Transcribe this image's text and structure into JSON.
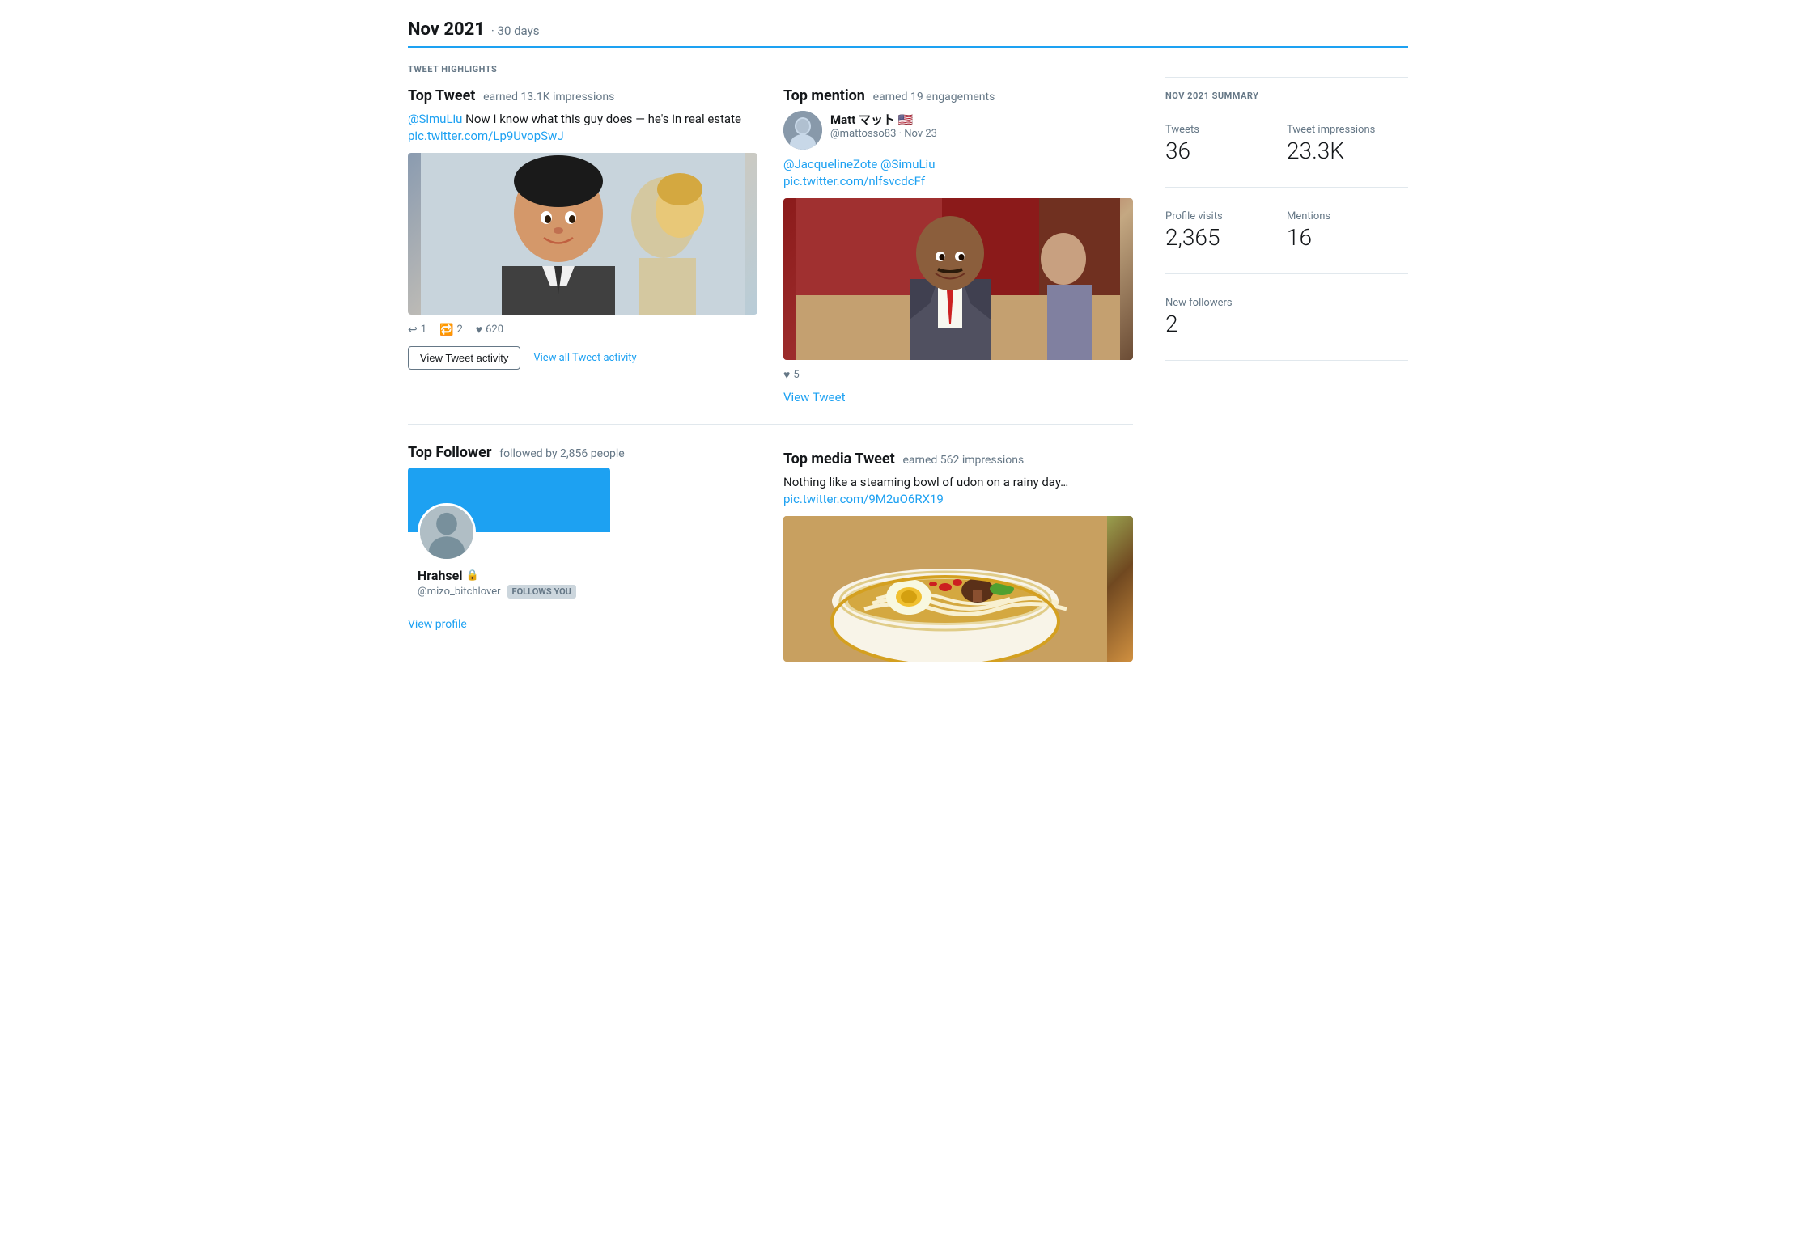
{
  "page": {
    "title": "Nov 2021",
    "subtitle": "· 30 days"
  },
  "highlights_label": "TWEET HIGHLIGHTS",
  "top_tweet": {
    "label": "Top Tweet",
    "impressions_text": "earned 13.1K impressions",
    "text_prefix": "@SimuLiu",
    "text_body": " Now I know what this guy does — he's in real estate",
    "text_link": "pic.twitter.com/Lp9UvopSwJ",
    "replies": "1",
    "retweets": "2",
    "likes": "620",
    "view_activity_label": "View Tweet activity",
    "view_all_label": "View all Tweet activity"
  },
  "top_mention": {
    "label": "Top mention",
    "engagements_text": "earned 19 engagements",
    "author_name": "Matt マット 🇺🇸",
    "author_handle": "@mattosso83",
    "author_date": "· Nov 23",
    "mention_text_link1": "@JacquelineZote",
    "mention_text_link2": "@SimuLiu",
    "mention_image_link": "pic.twitter.com/nlfsvcdcFf",
    "likes": "5",
    "view_tweet_label": "View Tweet"
  },
  "top_follower": {
    "label": "Top Follower",
    "followed_by": "followed by 2,856 people",
    "name": "Hrahsel",
    "handle": "@mizo_bitchlover",
    "follows_badge": "FOLLOWS YOU",
    "view_profile_label": "View profile"
  },
  "top_media": {
    "label": "Top media Tweet",
    "impressions_text": "earned 562 impressions",
    "text": "Nothing like a steaming bowl of udon on a rainy day…",
    "text_link": "pic.twitter.com/9M2uO6RX19"
  },
  "sidebar": {
    "section_label": "NOV 2021 SUMMARY",
    "tweets_label": "Tweets",
    "tweets_value": "36",
    "impressions_label": "Tweet impressions",
    "impressions_value": "23.3K",
    "profile_visits_label": "Profile visits",
    "profile_visits_value": "2,365",
    "mentions_label": "Mentions",
    "mentions_value": "16",
    "new_followers_label": "New followers",
    "new_followers_value": "2"
  },
  "colors": {
    "blue": "#1da1f2",
    "gray": "#657786",
    "border": "#e1e8ed"
  }
}
